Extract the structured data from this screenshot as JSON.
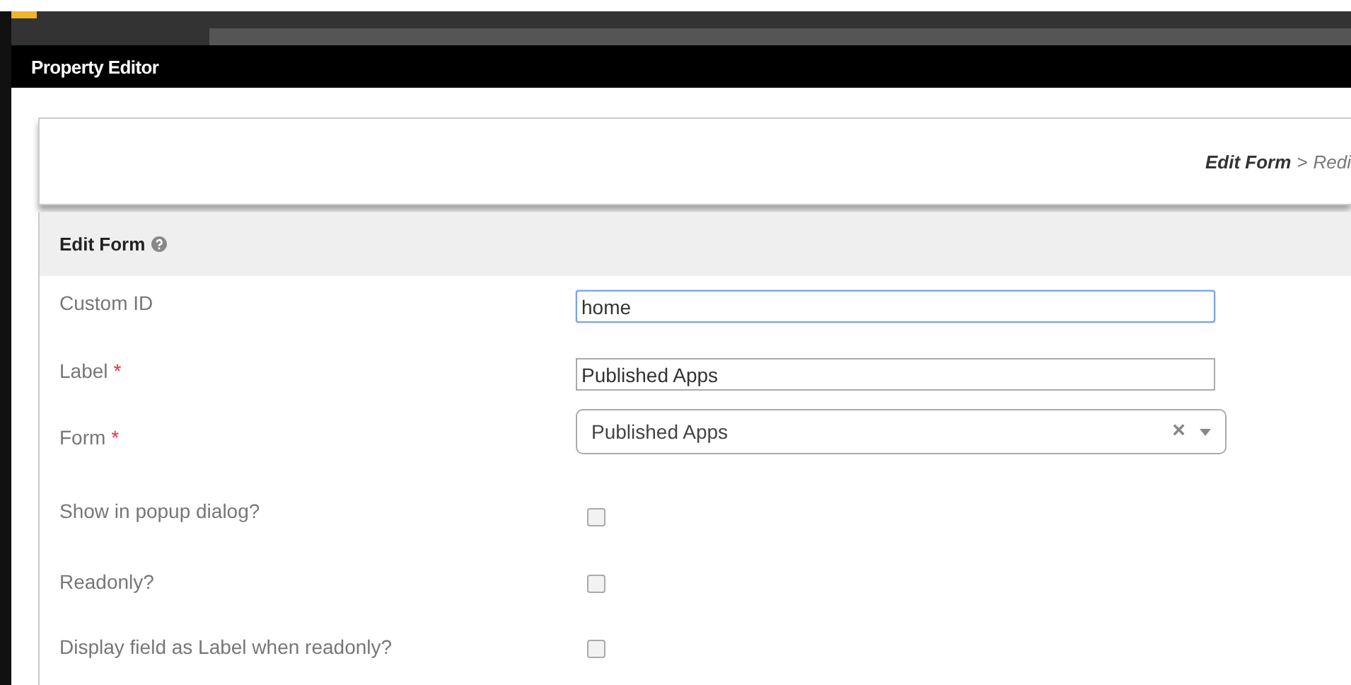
{
  "window": {
    "title": "Property Editor"
  },
  "breadcrumb": {
    "items": [
      "Edit Form",
      "Redi"
    ],
    "separator": ">"
  },
  "section": {
    "title": "Edit Form",
    "help": true
  },
  "fields": [
    {
      "kind": "text",
      "label": "Custom ID",
      "value": "home",
      "focused": true
    },
    {
      "kind": "text",
      "label": "Label",
      "required_mark": "*",
      "value": "Published Apps",
      "focused": false
    },
    {
      "kind": "select",
      "label": "Form",
      "required_mark": "*",
      "value": "Published Apps",
      "clear": "×"
    },
    {
      "kind": "checkbox",
      "label": "Show in popup dialog?",
      "checked": false
    },
    {
      "kind": "checkbox",
      "label": "Readonly?",
      "checked": false
    },
    {
      "kind": "checkbox",
      "label": "Display field as Label when readonly?",
      "checked": false
    }
  ]
}
